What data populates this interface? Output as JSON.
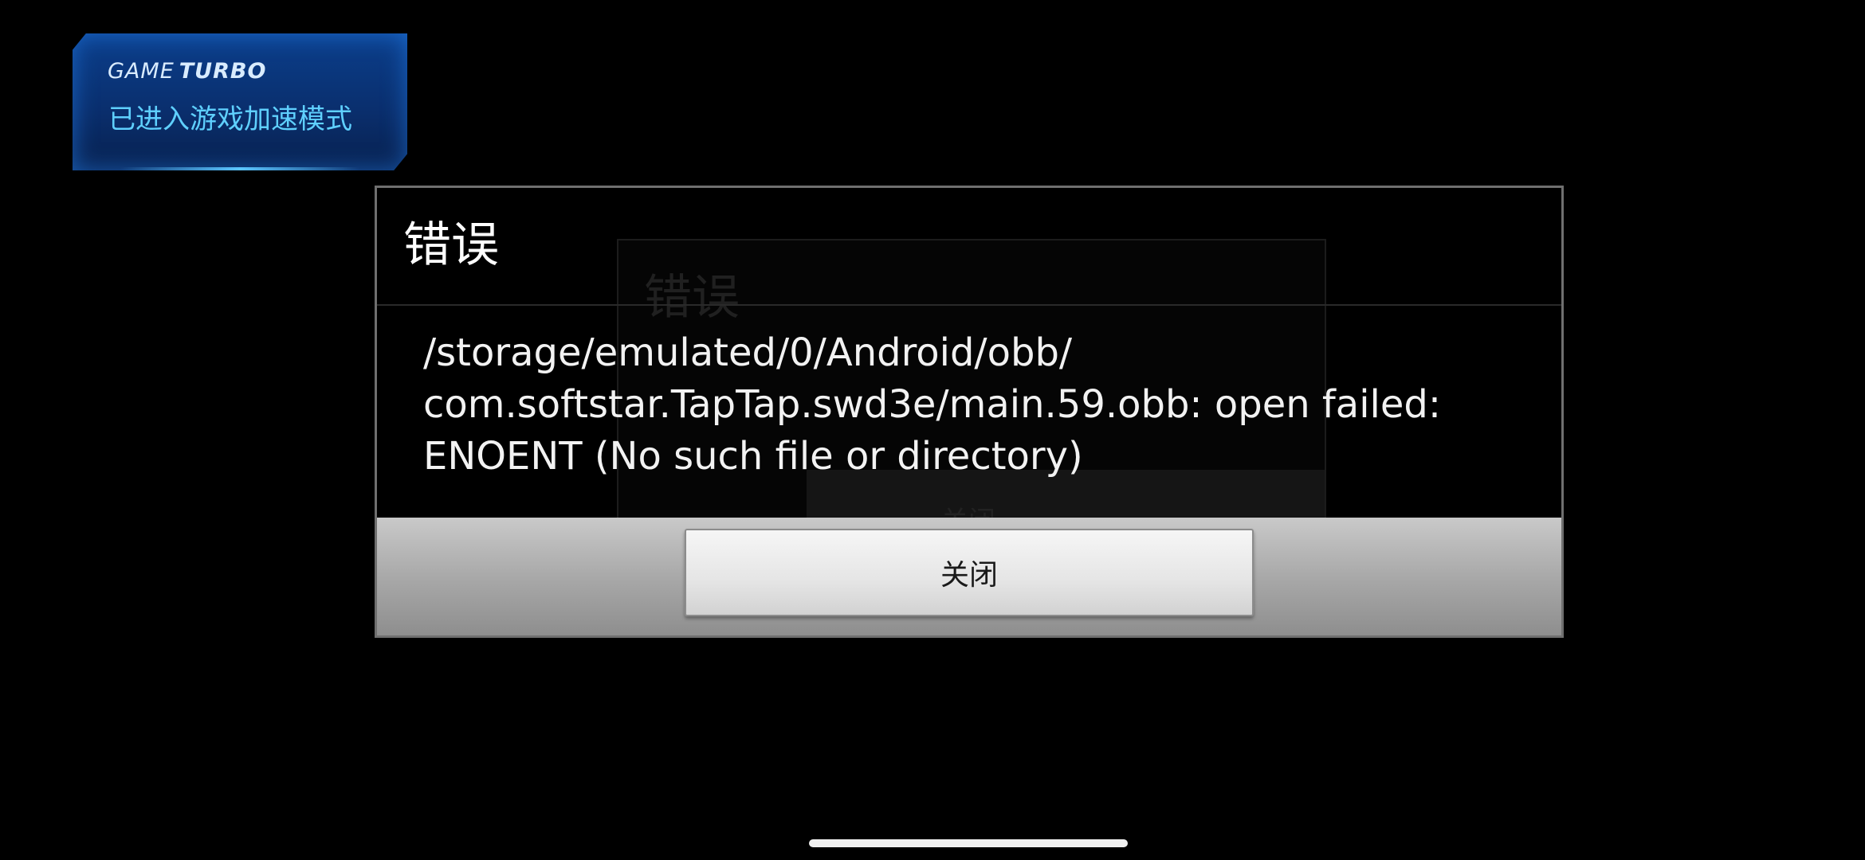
{
  "game_turbo": {
    "brand_light": "GAME",
    "brand_bold": "TURBO",
    "status_text": "已进入游戏加速模式"
  },
  "background_dialog": {
    "title": "错误",
    "button_label": "关闭"
  },
  "error_dialog": {
    "title": "错误",
    "message": "/storage/emulated/0/Android/obb/\ncom.softstar.TapTap.swd3e/main.59.obb: open failed:\nENOENT (No such file or directory)",
    "close_button_label": "关闭"
  },
  "colors": {
    "background": "#000000",
    "turbo_accent": "#5fd0ff",
    "dialog_text": "#ffffff",
    "button_bar": "#a9a9a9"
  }
}
